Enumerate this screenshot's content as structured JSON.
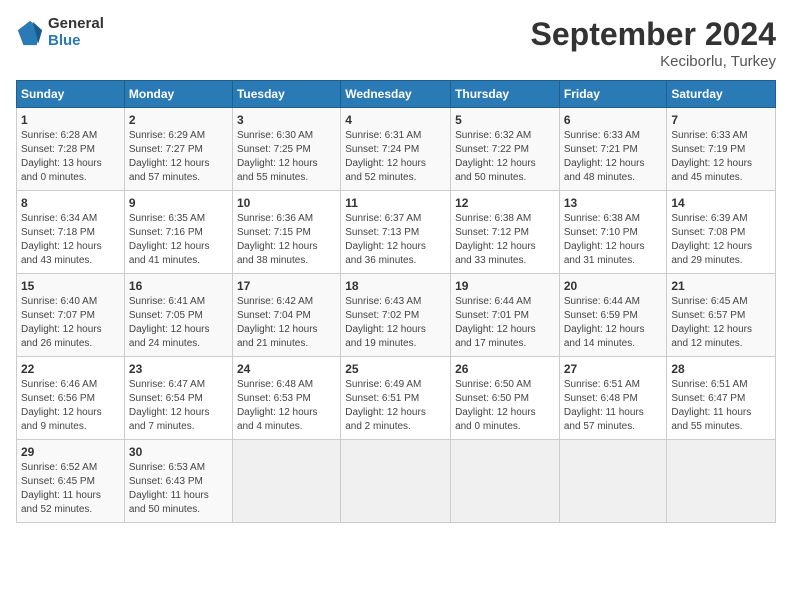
{
  "header": {
    "logo_general": "General",
    "logo_blue": "Blue",
    "month": "September 2024",
    "location": "Keciborlu, Turkey"
  },
  "weekdays": [
    "Sunday",
    "Monday",
    "Tuesday",
    "Wednesday",
    "Thursday",
    "Friday",
    "Saturday"
  ],
  "weeks": [
    [
      {
        "day": "1",
        "info": "Sunrise: 6:28 AM\nSunset: 7:28 PM\nDaylight: 13 hours\nand 0 minutes."
      },
      {
        "day": "2",
        "info": "Sunrise: 6:29 AM\nSunset: 7:27 PM\nDaylight: 12 hours\nand 57 minutes."
      },
      {
        "day": "3",
        "info": "Sunrise: 6:30 AM\nSunset: 7:25 PM\nDaylight: 12 hours\nand 55 minutes."
      },
      {
        "day": "4",
        "info": "Sunrise: 6:31 AM\nSunset: 7:24 PM\nDaylight: 12 hours\nand 52 minutes."
      },
      {
        "day": "5",
        "info": "Sunrise: 6:32 AM\nSunset: 7:22 PM\nDaylight: 12 hours\nand 50 minutes."
      },
      {
        "day": "6",
        "info": "Sunrise: 6:33 AM\nSunset: 7:21 PM\nDaylight: 12 hours\nand 48 minutes."
      },
      {
        "day": "7",
        "info": "Sunrise: 6:33 AM\nSunset: 7:19 PM\nDaylight: 12 hours\nand 45 minutes."
      }
    ],
    [
      {
        "day": "8",
        "info": "Sunrise: 6:34 AM\nSunset: 7:18 PM\nDaylight: 12 hours\nand 43 minutes."
      },
      {
        "day": "9",
        "info": "Sunrise: 6:35 AM\nSunset: 7:16 PM\nDaylight: 12 hours\nand 41 minutes."
      },
      {
        "day": "10",
        "info": "Sunrise: 6:36 AM\nSunset: 7:15 PM\nDaylight: 12 hours\nand 38 minutes."
      },
      {
        "day": "11",
        "info": "Sunrise: 6:37 AM\nSunset: 7:13 PM\nDaylight: 12 hours\nand 36 minutes."
      },
      {
        "day": "12",
        "info": "Sunrise: 6:38 AM\nSunset: 7:12 PM\nDaylight: 12 hours\nand 33 minutes."
      },
      {
        "day": "13",
        "info": "Sunrise: 6:38 AM\nSunset: 7:10 PM\nDaylight: 12 hours\nand 31 minutes."
      },
      {
        "day": "14",
        "info": "Sunrise: 6:39 AM\nSunset: 7:08 PM\nDaylight: 12 hours\nand 29 minutes."
      }
    ],
    [
      {
        "day": "15",
        "info": "Sunrise: 6:40 AM\nSunset: 7:07 PM\nDaylight: 12 hours\nand 26 minutes."
      },
      {
        "day": "16",
        "info": "Sunrise: 6:41 AM\nSunset: 7:05 PM\nDaylight: 12 hours\nand 24 minutes."
      },
      {
        "day": "17",
        "info": "Sunrise: 6:42 AM\nSunset: 7:04 PM\nDaylight: 12 hours\nand 21 minutes."
      },
      {
        "day": "18",
        "info": "Sunrise: 6:43 AM\nSunset: 7:02 PM\nDaylight: 12 hours\nand 19 minutes."
      },
      {
        "day": "19",
        "info": "Sunrise: 6:44 AM\nSunset: 7:01 PM\nDaylight: 12 hours\nand 17 minutes."
      },
      {
        "day": "20",
        "info": "Sunrise: 6:44 AM\nSunset: 6:59 PM\nDaylight: 12 hours\nand 14 minutes."
      },
      {
        "day": "21",
        "info": "Sunrise: 6:45 AM\nSunset: 6:57 PM\nDaylight: 12 hours\nand 12 minutes."
      }
    ],
    [
      {
        "day": "22",
        "info": "Sunrise: 6:46 AM\nSunset: 6:56 PM\nDaylight: 12 hours\nand 9 minutes."
      },
      {
        "day": "23",
        "info": "Sunrise: 6:47 AM\nSunset: 6:54 PM\nDaylight: 12 hours\nand 7 minutes."
      },
      {
        "day": "24",
        "info": "Sunrise: 6:48 AM\nSunset: 6:53 PM\nDaylight: 12 hours\nand 4 minutes."
      },
      {
        "day": "25",
        "info": "Sunrise: 6:49 AM\nSunset: 6:51 PM\nDaylight: 12 hours\nand 2 minutes."
      },
      {
        "day": "26",
        "info": "Sunrise: 6:50 AM\nSunset: 6:50 PM\nDaylight: 12 hours\nand 0 minutes."
      },
      {
        "day": "27",
        "info": "Sunrise: 6:51 AM\nSunset: 6:48 PM\nDaylight: 11 hours\nand 57 minutes."
      },
      {
        "day": "28",
        "info": "Sunrise: 6:51 AM\nSunset: 6:47 PM\nDaylight: 11 hours\nand 55 minutes."
      }
    ],
    [
      {
        "day": "29",
        "info": "Sunrise: 6:52 AM\nSunset: 6:45 PM\nDaylight: 11 hours\nand 52 minutes."
      },
      {
        "day": "30",
        "info": "Sunrise: 6:53 AM\nSunset: 6:43 PM\nDaylight: 11 hours\nand 50 minutes."
      },
      {
        "day": "",
        "info": ""
      },
      {
        "day": "",
        "info": ""
      },
      {
        "day": "",
        "info": ""
      },
      {
        "day": "",
        "info": ""
      },
      {
        "day": "",
        "info": ""
      }
    ]
  ]
}
